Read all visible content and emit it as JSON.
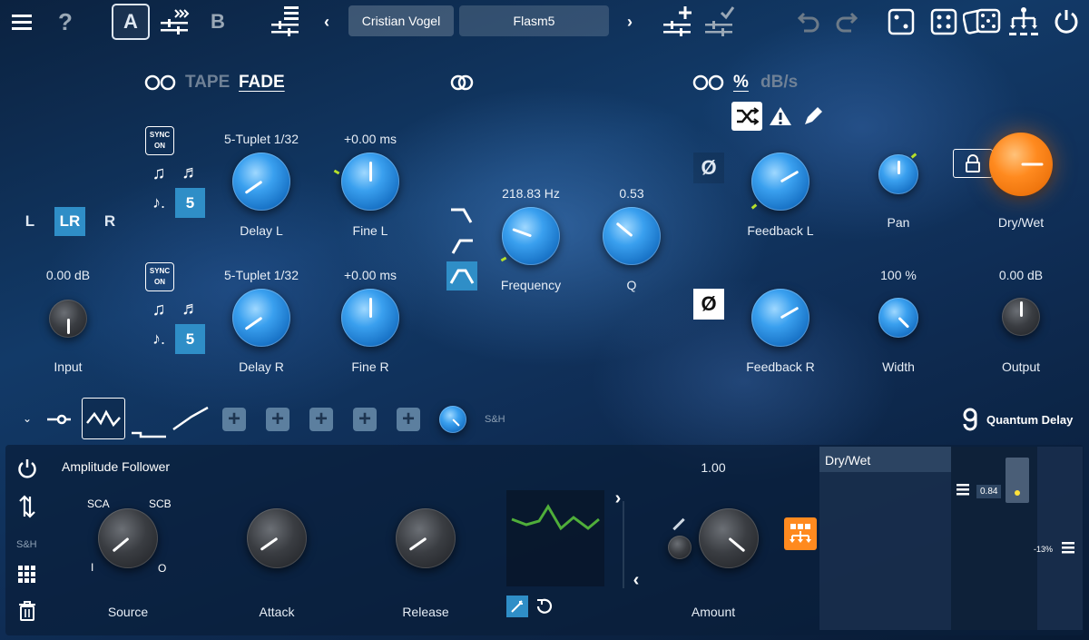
{
  "toolbar": {
    "ab_a": "A",
    "ab_b": "B",
    "preset_author": "Cristian Vogel",
    "preset_name": "Flasm5"
  },
  "tape": {
    "tape_label": "TAPE",
    "fade_label": "FADE"
  },
  "feedback_units": {
    "percent": "%",
    "dbs": "dB/s"
  },
  "channels": {
    "l": "L",
    "lr": "LR",
    "r": "R"
  },
  "delay": {
    "sync_l1": "SYNC",
    "sync_l2": "ON",
    "tuplet": "5",
    "delay_l_value": "5-Tuplet 1/32",
    "delay_l_label": "Delay L",
    "fine_l_value": "+0.00 ms",
    "fine_l_label": "Fine L",
    "delay_r_value": "5-Tuplet 1/32",
    "delay_r_label": "Delay R",
    "fine_r_value": "+0.00 ms",
    "fine_r_label": "Fine R"
  },
  "input": {
    "value": "0.00 dB",
    "label": "Input"
  },
  "filter": {
    "freq_value": "218.83 Hz",
    "freq_label": "Frequency",
    "q_value": "0.53",
    "q_label": "Q"
  },
  "feedback": {
    "phase": "Ø",
    "fb_l_label": "Feedback L",
    "fb_r_label": "Feedback R"
  },
  "mix": {
    "pan_label": "Pan",
    "width_value": "100 %",
    "width_label": "Width",
    "drywet_label": "Dry/Wet",
    "output_value": "0.00 dB",
    "output_label": "Output"
  },
  "mod": {
    "sh": "S&H",
    "brand": "Quantum Delay",
    "title": "Amplitude Follower",
    "sca": "SCA",
    "scb": "SCB",
    "i": "I",
    "o": "O",
    "source_label": "Source",
    "attack_label": "Attack",
    "release_label": "Release",
    "amount_value": "1.00",
    "amount_label": "Amount",
    "target": "Dry/Wet",
    "target_value": "0.84",
    "target_min": "-13%"
  },
  "colors": {
    "accent": "#2f8ec7",
    "orange": "#ff8a1f",
    "green": "#4fae3a"
  }
}
